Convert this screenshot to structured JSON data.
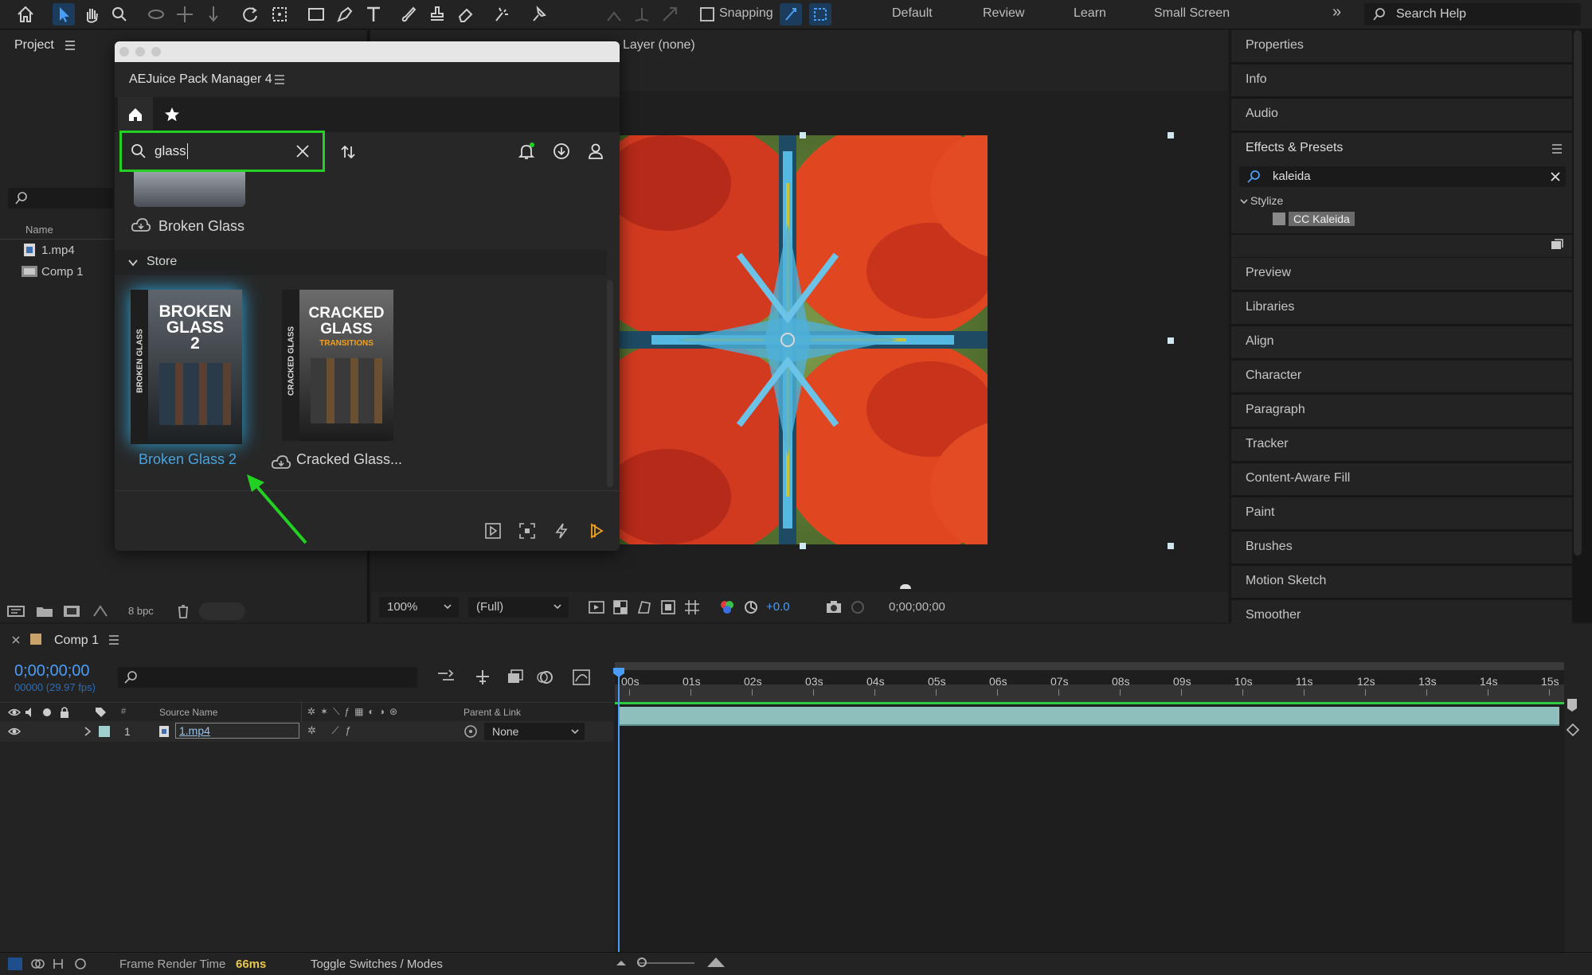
{
  "toolbar": {
    "snapping_label": "Snapping",
    "workspaces": [
      "Default",
      "Review",
      "Learn",
      "Small Screen"
    ],
    "more_label": "»",
    "search_placeholder": "Search Help"
  },
  "project": {
    "title": "Project",
    "col_name": "Name",
    "items": [
      {
        "name": "1.mp4",
        "icon": "footage-icon"
      },
      {
        "name": "Comp 1",
        "icon": "composition-icon"
      }
    ],
    "bpc": "8 bpc"
  },
  "viewer": {
    "layer_label": "Layer (none)",
    "zoom": "100%",
    "resolution": "(Full)",
    "exposure": "+0.0",
    "timecode": "0;00;00;00"
  },
  "plugin": {
    "title": "AEJuice Pack Manager 4",
    "search_value": "glass",
    "installed_item": "Broken Glass",
    "section_label": "Store",
    "store_items": [
      {
        "name": "Broken Glass 2",
        "box_line1": "BROKEN",
        "box_line2": "GLASS",
        "box_line3": "2",
        "side": "BROKEN GLASS",
        "selected": true
      },
      {
        "name": "Cracked Glass...",
        "box_line1": "CRACKED",
        "box_line2": "GLASS",
        "box_line3": "TRANSITIONS",
        "side": "CRACKED GLASS",
        "selected": false
      }
    ],
    "highlight_color": "#22d122",
    "link_color": "#4aa3df"
  },
  "right_panel": {
    "items_top": [
      "Properties",
      "Info",
      "Audio"
    ],
    "effects_title": "Effects & Presets",
    "effects_search": "kaleida",
    "category": "Stylize",
    "effect": "CC Kaleida",
    "items_bottom": [
      "Preview",
      "Libraries",
      "Align",
      "Character",
      "Paragraph",
      "Tracker",
      "Content-Aware Fill",
      "Paint",
      "Brushes",
      "Motion Sketch",
      "Smoother"
    ]
  },
  "timeline": {
    "comp_name": "Comp 1",
    "timecode": "0;00;00;00",
    "frame_info": "00000 (29.97 fps)",
    "col_source_name": "Source Name",
    "col_parent": "Parent & Link",
    "col_num": "#",
    "layer_num": "1",
    "layer_name": "1.mp4",
    "parent_value": "None",
    "ruler": [
      "00s",
      "01s",
      "02s",
      "03s",
      "04s",
      "05s",
      "06s",
      "07s",
      "08s",
      "09s",
      "10s",
      "11s",
      "12s",
      "13s",
      "14s",
      "15s"
    ],
    "frame_render_label": "Frame Render Time",
    "frame_render_value": "66ms",
    "toggle_label": "Toggle Switches / Modes"
  }
}
